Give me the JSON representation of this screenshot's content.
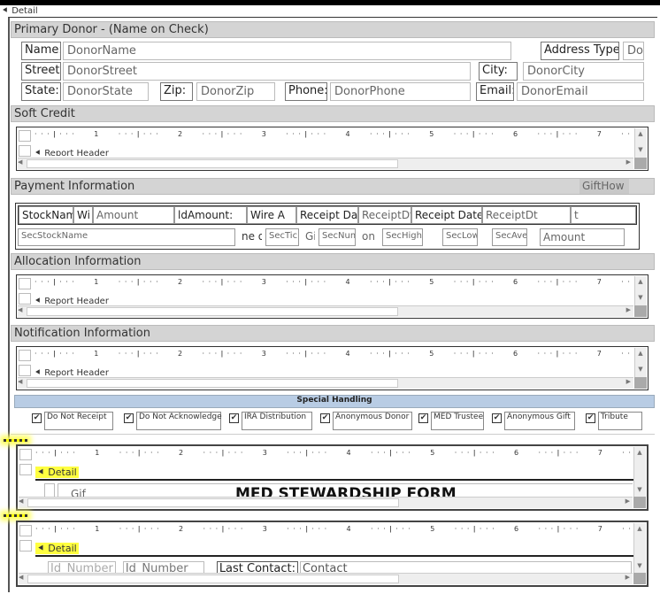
{
  "section_header": "Detail",
  "primary_donor": {
    "title": "Primary Donor - (Name on Check)",
    "name_label": "Name:",
    "name": "DonorName",
    "address_type_label": "Address Type:",
    "address_type": "Dor",
    "street_label": "Street:",
    "street": "DonorStreet",
    "city_label": "City:",
    "city": "DonorCity",
    "state_label": "State:",
    "state": "DonorState",
    "zip_label": "Zip:",
    "zip": "DonorZip",
    "phone_label": "Phone:",
    "phone": "DonorPhone",
    "email_label": "Email:",
    "email": "DonorEmail"
  },
  "soft_credit": {
    "title": "Soft Credit",
    "section": "Report Header"
  },
  "payment": {
    "title": "Payment Information",
    "gift_how": "GiftHow",
    "row1": [
      "StockName:",
      "Wi",
      "Amount",
      "ldAmount:",
      "Wire A",
      "Receipt Date:",
      "ReceiptDt",
      "Receipt Date:",
      "ReceiptDt",
      "t"
    ],
    "row2": [
      "SecStockName",
      "ne o",
      "SecTick",
      "Gi",
      "SecNum",
      "on C",
      "SecHigh",
      "SecLow",
      "SecAve",
      "Amount"
    ]
  },
  "allocation": {
    "title": "Allocation Information",
    "section": "Report Header"
  },
  "notification": {
    "title": "Notification Information",
    "section": "Report Header"
  },
  "ruler": [
    "1",
    "2",
    "3",
    "4",
    "5",
    "6",
    "7"
  ],
  "special_handling": {
    "title": "Special Handling",
    "items": [
      {
        "label": "Do Not Receipt",
        "checked": true
      },
      {
        "label": "Do Not Acknowledge",
        "checked": true
      },
      {
        "label": "IRA Distribution",
        "checked": true
      },
      {
        "label": "Anonymous Donor",
        "checked": true
      },
      {
        "label": "MED Trustee",
        "checked": true
      },
      {
        "label": "Anonymous Gift",
        "checked": true
      },
      {
        "label": "Tribute",
        "checked": true
      }
    ]
  },
  "sub5": {
    "section": "Detail",
    "gif": "Gif",
    "title": "MED STEWARDSHIP FORM"
  },
  "sub6": {
    "section": "Detail",
    "id1": "Id_Number",
    "id2": "Id_Number",
    "last_contact_label": "Last Contact:",
    "contact": "Contact"
  },
  "check_glyph": "✔"
}
